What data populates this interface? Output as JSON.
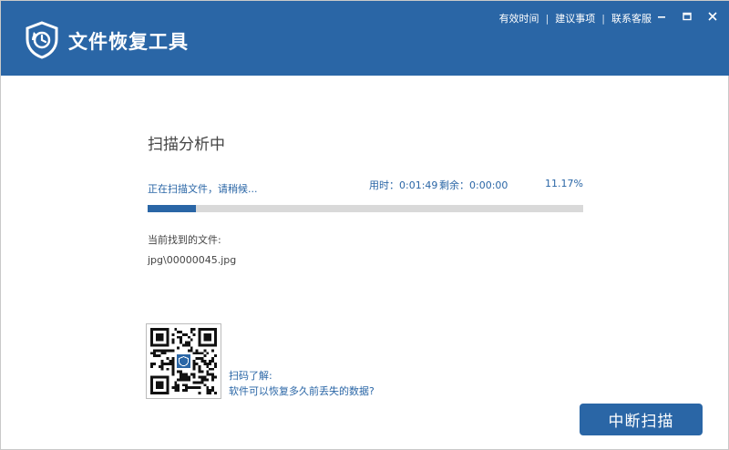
{
  "app": {
    "title": "文件恢复工具"
  },
  "top_links": {
    "validity": "有效时间",
    "suggestions": "建议事项",
    "contact": "联系客服",
    "separator": "|"
  },
  "scan": {
    "title": "扫描分析中",
    "status": "正在扫描文件，请稍候...",
    "time_used": "用时：0:01:49",
    "time_left": "剩余：0:00:00",
    "percent_text": "11.17%",
    "progress_fraction": 0.1117
  },
  "found": {
    "label": "当前找到的文件:",
    "file": "jpg\\00000045.jpg"
  },
  "qr": {
    "hint": "扫码了解:",
    "link": "软件可以恢复多久前丢失的数据?"
  },
  "actions": {
    "stop_label": "中断扫描"
  },
  "icons": {
    "logo": "shield-clock-icon",
    "minimize": "minimize-icon",
    "maximize": "maximize-icon",
    "close": "close-icon"
  },
  "colors": {
    "brand": "#2a66a6",
    "track": "#d9d9d9"
  }
}
